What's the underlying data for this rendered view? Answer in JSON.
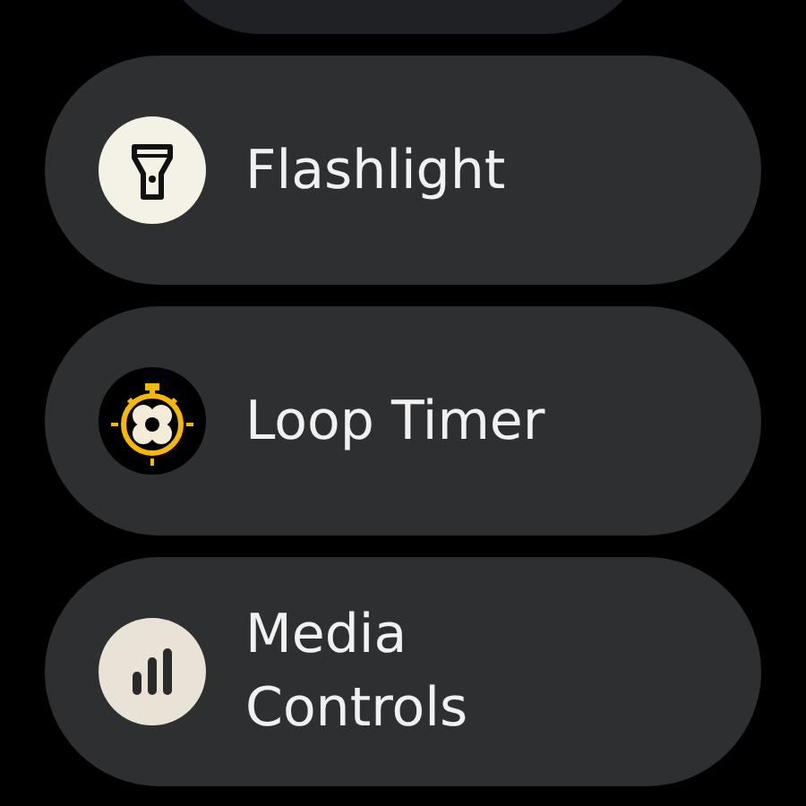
{
  "apps": [
    {
      "kind": "cut"
    },
    {
      "kind": "app",
      "label": "Flashlight"
    },
    {
      "kind": "app",
      "label": "Loop Timer"
    },
    {
      "kind": "app",
      "label": "Media Controls"
    }
  ]
}
